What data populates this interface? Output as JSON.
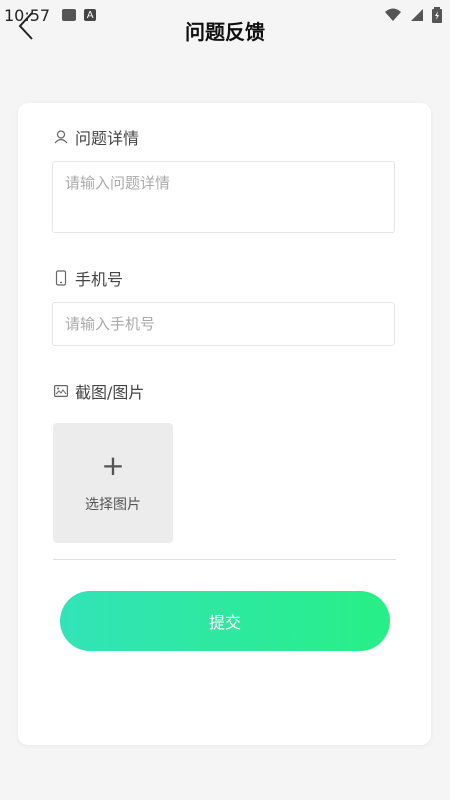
{
  "statusbar": {
    "time": "10:57",
    "left_icons": [
      "image-icon",
      "text-icon"
    ],
    "right_icons": [
      "wifi-icon",
      "signal-icon",
      "battery-icon"
    ]
  },
  "header": {
    "title": "问题反馈",
    "back_icon": "chevron-left-icon"
  },
  "form": {
    "details": {
      "label": "问题详情",
      "icon": "user-icon",
      "placeholder": "请输入问题详情",
      "value": ""
    },
    "phone": {
      "label": "手机号",
      "icon": "phone-icon",
      "placeholder": "请输入手机号",
      "value": ""
    },
    "screenshot": {
      "label": "截图/图片",
      "icon": "image-icon",
      "picker_label": "选择图片",
      "plus": "+"
    },
    "submit_label": "提交"
  },
  "colors": {
    "background": "#f5f5f5",
    "card": "#ffffff",
    "submit_gradient_start": "#33e3b8",
    "submit_gradient_end": "#27ef86"
  }
}
